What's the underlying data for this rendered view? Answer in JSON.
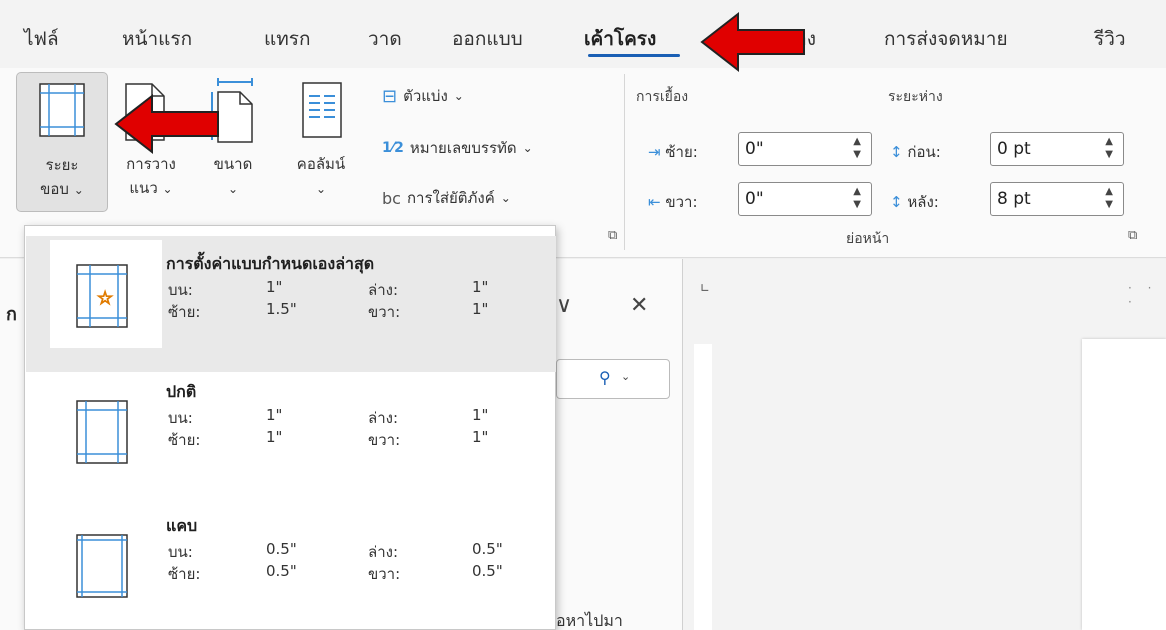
{
  "tabs": [
    {
      "label": "ไฟล์"
    },
    {
      "label": "หน้าแรก"
    },
    {
      "label": "แทรก"
    },
    {
      "label": "วาด"
    },
    {
      "label": "ออกแบบ"
    },
    {
      "label": "เค้าโครง",
      "active": true
    },
    {
      "label": "อ้างอิง"
    },
    {
      "label": "การส่งจดหมาย"
    },
    {
      "label": "รีวิว"
    }
  ],
  "ribbon": {
    "margins": {
      "line1": "ระยะ",
      "line2": "ขอบ"
    },
    "orientation": {
      "line1": "การวาง",
      "line2": "แนว"
    },
    "size": {
      "line1": "ขนาด"
    },
    "columns": {
      "line1": "คอลัมน์"
    },
    "breaks": "ตัวแบ่ง",
    "line_numbers": "หมายเลขบรรทัด",
    "hyphenation": "การใส่ยัติภังค์",
    "indent": {
      "title": "การเยื้อง",
      "left_label": "ซ้าย:",
      "left_value": "0\"",
      "right_label": "ขวา:",
      "right_value": "0\""
    },
    "spacing": {
      "title": "ระยะห่าง",
      "before_label": "ก่อน:",
      "before_value": "0 pt",
      "after_label": "หลัง:",
      "after_value": "8 pt"
    },
    "paragraph_group": "ย่อหน้า"
  },
  "background": {
    "pane_text": "อหาไปมา"
  },
  "margin_options": [
    {
      "name": "การตั้งค่าแบบกำหนดเองล่าสุด",
      "top_label": "บน:",
      "top": "1\"",
      "bottom_label": "ล่าง:",
      "bottom": "1\"",
      "left_label": "ซ้าย:",
      "left": "1.5\"",
      "right_label": "ขวา:",
      "right": "1\"",
      "highlighted": true
    },
    {
      "name": "ปกติ",
      "top_label": "บน:",
      "top": "1\"",
      "bottom_label": "ล่าง:",
      "bottom": "1\"",
      "left_label": "ซ้าย:",
      "left": "1\"",
      "right_label": "ขวา:",
      "right": "1\""
    },
    {
      "name": "แคบ",
      "top_label": "บน:",
      "top": "0.5\"",
      "bottom_label": "ล่าง:",
      "bottom": "0.5\"",
      "left_label": "ซ้าย:",
      "left": "0.5\"",
      "right_label": "ขวา:",
      "right": "0.5\""
    }
  ],
  "colors": {
    "accent": "#1a5fb4",
    "arrow_red": "#e00000",
    "margin_line": "#3b8fd9",
    "star": "#e07b00"
  }
}
